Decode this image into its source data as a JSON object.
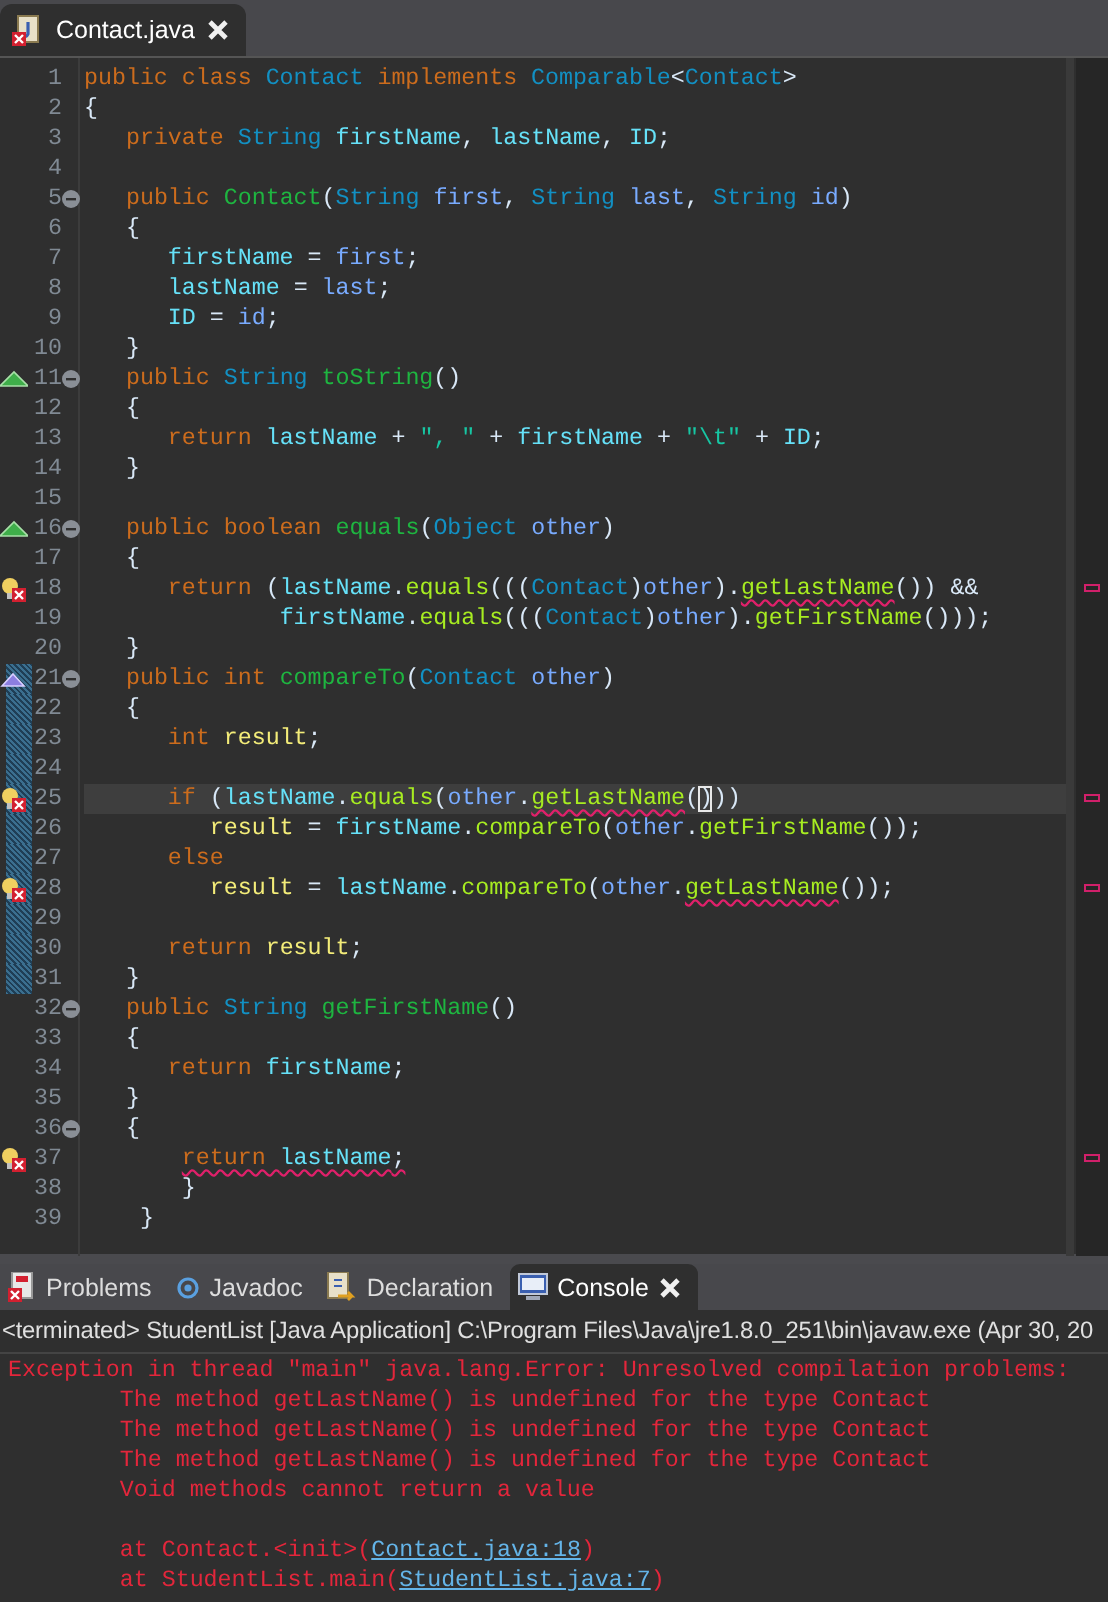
{
  "editor": {
    "tabs": [
      {
        "label": "Contact.java",
        "selected": true,
        "has_error": true
      }
    ],
    "lines": [
      {
        "number": "1",
        "fold": false,
        "changed": false,
        "current": false,
        "tokens": [
          {
            "text": "public class ",
            "kind": "keyword",
            "underlined": false
          },
          {
            "text": "Contact ",
            "kind": "type",
            "underlined": false
          },
          {
            "text": "implements ",
            "kind": "keyword",
            "underlined": false
          },
          {
            "text": "Comparable",
            "kind": "type",
            "underlined": false
          },
          {
            "text": "<",
            "kind": "plain",
            "underlined": false
          },
          {
            "text": "Contact",
            "kind": "type",
            "underlined": false
          },
          {
            "text": ">",
            "kind": "plain",
            "underlined": false
          }
        ]
      },
      {
        "number": "2",
        "fold": false,
        "changed": false,
        "current": false,
        "tokens": [
          {
            "text": "{",
            "kind": "plain",
            "underlined": false
          }
        ]
      },
      {
        "number": "3",
        "fold": false,
        "changed": false,
        "current": false,
        "tokens": [
          {
            "text": "   private ",
            "kind": "keyword",
            "underlined": false
          },
          {
            "text": "String ",
            "kind": "type",
            "underlined": false
          },
          {
            "text": "firstName",
            "kind": "field",
            "underlined": false
          },
          {
            "text": ", ",
            "kind": "plain",
            "underlined": false
          },
          {
            "text": "lastName",
            "kind": "field",
            "underlined": false
          },
          {
            "text": ", ",
            "kind": "plain",
            "underlined": false
          },
          {
            "text": "ID",
            "kind": "field",
            "underlined": false
          },
          {
            "text": ";",
            "kind": "plain",
            "underlined": false
          }
        ]
      },
      {
        "number": "4",
        "fold": false,
        "changed": false,
        "current": false
      },
      {
        "number": "5",
        "fold": true,
        "changed": false,
        "current": false,
        "tokens": [
          {
            "text": "   public ",
            "kind": "keyword",
            "underlined": false
          },
          {
            "text": "Contact",
            "kind": "declaration",
            "underlined": false
          },
          {
            "text": "(",
            "kind": "plain",
            "underlined": false
          },
          {
            "text": "String ",
            "kind": "type",
            "underlined": false
          },
          {
            "text": "first",
            "kind": "parameter",
            "underlined": false
          },
          {
            "text": ", ",
            "kind": "plain",
            "underlined": false
          },
          {
            "text": "String ",
            "kind": "type",
            "underlined": false
          },
          {
            "text": "last",
            "kind": "parameter",
            "underlined": false
          },
          {
            "text": ", ",
            "kind": "plain",
            "underlined": false
          },
          {
            "text": "String ",
            "kind": "type",
            "underlined": false
          },
          {
            "text": "id",
            "kind": "parameter",
            "underlined": false
          },
          {
            "text": ")",
            "kind": "plain",
            "underlined": false
          }
        ]
      },
      {
        "number": "6",
        "fold": false,
        "changed": false,
        "current": false,
        "tokens": [
          {
            "text": "   {",
            "kind": "plain",
            "underlined": false
          }
        ]
      },
      {
        "number": "7",
        "fold": false,
        "changed": false,
        "current": false,
        "tokens": [
          {
            "text": "      firstName",
            "kind": "field",
            "underlined": false
          },
          {
            "text": " = ",
            "kind": "plain",
            "underlined": false
          },
          {
            "text": "first",
            "kind": "parameter",
            "underlined": false
          },
          {
            "text": ";",
            "kind": "plain",
            "underlined": false
          }
        ]
      },
      {
        "number": "8",
        "fold": false,
        "changed": false,
        "current": false,
        "tokens": [
          {
            "text": "      lastName",
            "kind": "field",
            "underlined": false
          },
          {
            "text": " = ",
            "kind": "plain",
            "underlined": false
          },
          {
            "text": "last",
            "kind": "parameter",
            "underlined": false
          },
          {
            "text": ";",
            "kind": "plain",
            "underlined": false
          }
        ]
      },
      {
        "number": "9",
        "fold": false,
        "changed": false,
        "current": false,
        "tokens": [
          {
            "text": "      ID",
            "kind": "field",
            "underlined": false
          },
          {
            "text": " = ",
            "kind": "plain",
            "underlined": false
          },
          {
            "text": "id",
            "kind": "parameter",
            "underlined": false
          },
          {
            "text": ";",
            "kind": "plain",
            "underlined": false
          }
        ]
      },
      {
        "number": "10",
        "fold": false,
        "changed": false,
        "current": false,
        "tokens": [
          {
            "text": "   }",
            "kind": "plain",
            "underlined": false
          }
        ]
      },
      {
        "number": "11",
        "kind": "override",
        "fold": true,
        "changed": false,
        "current": false,
        "tokens": [
          {
            "text": "   public ",
            "kind": "keyword",
            "underlined": false
          },
          {
            "text": "String ",
            "kind": "type",
            "underlined": false
          },
          {
            "text": "toString",
            "kind": "declaration",
            "underlined": false
          },
          {
            "text": "()",
            "kind": "plain",
            "underlined": false
          }
        ]
      },
      {
        "number": "12",
        "fold": false,
        "changed": false,
        "current": false,
        "tokens": [
          {
            "text": "   {",
            "kind": "plain",
            "underlined": false
          }
        ]
      },
      {
        "number": "13",
        "fold": false,
        "changed": false,
        "current": false,
        "tokens": [
          {
            "text": "      return ",
            "kind": "keyword",
            "underlined": false
          },
          {
            "text": "lastName",
            "kind": "field",
            "underlined": false
          },
          {
            "text": " + ",
            "kind": "plain",
            "underlined": false
          },
          {
            "text": "\", \"",
            "kind": "string",
            "underlined": false
          },
          {
            "text": " + ",
            "kind": "plain",
            "underlined": false
          },
          {
            "text": "firstName",
            "kind": "field",
            "underlined": false
          },
          {
            "text": " + ",
            "kind": "plain",
            "underlined": false
          },
          {
            "text": "\"\\t\"",
            "kind": "string",
            "underlined": false
          },
          {
            "text": " + ",
            "kind": "plain",
            "underlined": false
          },
          {
            "text": "ID",
            "kind": "field",
            "underlined": false
          },
          {
            "text": ";",
            "kind": "plain",
            "underlined": false
          }
        ]
      },
      {
        "number": "14",
        "fold": false,
        "changed": false,
        "current": false,
        "tokens": [
          {
            "text": "   }",
            "kind": "plain",
            "underlined": false
          }
        ]
      },
      {
        "number": "15",
        "fold": false,
        "changed": false,
        "current": false
      },
      {
        "number": "16",
        "kind": "override",
        "fold": true,
        "changed": false,
        "current": false,
        "tokens": [
          {
            "text": "   public boolean ",
            "kind": "keyword",
            "underlined": false
          },
          {
            "text": "equals",
            "kind": "declaration",
            "underlined": false
          },
          {
            "text": "(",
            "kind": "plain",
            "underlined": false
          },
          {
            "text": "Object ",
            "kind": "type",
            "underlined": false
          },
          {
            "text": "other",
            "kind": "parameter",
            "underlined": false
          },
          {
            "text": ")",
            "kind": "plain",
            "underlined": false
          }
        ]
      },
      {
        "number": "17",
        "fold": false,
        "changed": false,
        "current": false,
        "tokens": [
          {
            "text": "   {",
            "kind": "plain",
            "underlined": false
          }
        ]
      },
      {
        "number": "18",
        "kind": "error",
        "fold": false,
        "changed": false,
        "current": false,
        "tokens": [
          {
            "text": "      return ",
            "kind": "keyword",
            "underlined": false
          },
          {
            "text": "(",
            "kind": "plain",
            "underlined": false
          },
          {
            "text": "lastName",
            "kind": "field",
            "underlined": false
          },
          {
            "text": ".",
            "kind": "plain",
            "underlined": false
          },
          {
            "text": "equals",
            "kind": "call",
            "underlined": false
          },
          {
            "text": "(((",
            "kind": "plain",
            "underlined": false
          },
          {
            "text": "Contact",
            "kind": "type",
            "underlined": false
          },
          {
            "text": ")",
            "kind": "plain",
            "underlined": false
          },
          {
            "text": "other",
            "kind": "parameter",
            "underlined": false
          },
          {
            "text": ").",
            "kind": "plain",
            "underlined": false
          },
          {
            "text": "getLastName",
            "kind": "call",
            "underlined": true
          },
          {
            "text": "()) &&",
            "kind": "plain",
            "underlined": false
          }
        ]
      },
      {
        "number": "19",
        "fold": false,
        "changed": false,
        "current": false,
        "tokens": [
          {
            "text": "              firstName",
            "kind": "field",
            "underlined": false
          },
          {
            "text": ".",
            "kind": "plain",
            "underlined": false
          },
          {
            "text": "equals",
            "kind": "call",
            "underlined": false
          },
          {
            "text": "(((",
            "kind": "plain",
            "underlined": false
          },
          {
            "text": "Contact",
            "kind": "type",
            "underlined": false
          },
          {
            "text": ")",
            "kind": "plain",
            "underlined": false
          },
          {
            "text": "other",
            "kind": "parameter",
            "underlined": false
          },
          {
            "text": ").",
            "kind": "plain",
            "underlined": false
          },
          {
            "text": "getFirstName",
            "kind": "call",
            "underlined": false
          },
          {
            "text": "()));",
            "kind": "plain",
            "underlined": false
          }
        ]
      },
      {
        "number": "20",
        "fold": false,
        "changed": false,
        "current": false,
        "tokens": [
          {
            "text": "   }",
            "kind": "plain",
            "underlined": false
          }
        ]
      },
      {
        "number": "21",
        "kind": "implements",
        "fold": true,
        "changed": true,
        "current": false,
        "tokens": [
          {
            "text": "   public int ",
            "kind": "keyword",
            "underlined": false
          },
          {
            "text": "compareTo",
            "kind": "declaration",
            "underlined": false
          },
          {
            "text": "(",
            "kind": "plain",
            "underlined": false
          },
          {
            "text": "Contact ",
            "kind": "type",
            "underlined": false
          },
          {
            "text": "other",
            "kind": "parameter",
            "underlined": false
          },
          {
            "text": ")",
            "kind": "plain",
            "underlined": false
          }
        ]
      },
      {
        "number": "22",
        "fold": false,
        "changed": true,
        "current": false,
        "tokens": [
          {
            "text": "   {",
            "kind": "plain",
            "underlined": false
          }
        ]
      },
      {
        "number": "23",
        "fold": false,
        "changed": true,
        "current": false,
        "tokens": [
          {
            "text": "      int ",
            "kind": "keyword",
            "underlined": false
          },
          {
            "text": "result",
            "kind": "local",
            "underlined": false
          },
          {
            "text": ";",
            "kind": "plain",
            "underlined": false
          }
        ]
      },
      {
        "number": "24",
        "fold": false,
        "changed": true,
        "current": false
      },
      {
        "number": "25",
        "kind": "error",
        "fold": false,
        "changed": true,
        "current": true,
        "tokens": [
          {
            "text": "      if ",
            "kind": "keyword",
            "underlined": false
          },
          {
            "text": "(",
            "kind": "plain",
            "underlined": false
          },
          {
            "text": "lastName",
            "kind": "field",
            "underlined": false
          },
          {
            "text": ".",
            "kind": "plain",
            "underlined": false
          },
          {
            "text": "equals",
            "kind": "call",
            "underlined": false
          },
          {
            "text": "(",
            "kind": "plain",
            "underlined": false
          },
          {
            "text": "other",
            "kind": "parameter",
            "underlined": false
          },
          {
            "text": ".",
            "kind": "plain",
            "underlined": false
          },
          {
            "text": "getLastName",
            "kind": "call",
            "underlined": true
          },
          {
            "text": "(",
            "kind": "plain",
            "underlined": false
          },
          {
            "text": ")",
            "kind": "bracket",
            "underlined": false
          },
          {
            "text": "))",
            "kind": "plain",
            "underlined": false
          }
        ]
      },
      {
        "number": "26",
        "fold": false,
        "changed": true,
        "current": false,
        "tokens": [
          {
            "text": "         result",
            "kind": "local",
            "underlined": false
          },
          {
            "text": " = ",
            "kind": "plain",
            "underlined": false
          },
          {
            "text": "firstName",
            "kind": "field",
            "underlined": false
          },
          {
            "text": ".",
            "kind": "plain",
            "underlined": false
          },
          {
            "text": "compareTo",
            "kind": "call",
            "underlined": false
          },
          {
            "text": "(",
            "kind": "plain",
            "underlined": false
          },
          {
            "text": "other",
            "kind": "parameter",
            "underlined": false
          },
          {
            "text": ".",
            "kind": "plain",
            "underlined": false
          },
          {
            "text": "getFirstName",
            "kind": "call",
            "underlined": false
          },
          {
            "text": "());",
            "kind": "plain",
            "underlined": false
          }
        ]
      },
      {
        "number": "27",
        "fold": false,
        "changed": true,
        "current": false,
        "tokens": [
          {
            "text": "      else",
            "kind": "keyword",
            "underlined": false
          }
        ]
      },
      {
        "number": "28",
        "kind": "error",
        "fold": false,
        "changed": true,
        "current": false,
        "tokens": [
          {
            "text": "         result",
            "kind": "local",
            "underlined": false
          },
          {
            "text": " = ",
            "kind": "plain",
            "underlined": false
          },
          {
            "text": "lastName",
            "kind": "field",
            "underlined": false
          },
          {
            "text": ".",
            "kind": "plain",
            "underlined": false
          },
          {
            "text": "compareTo",
            "kind": "call",
            "underlined": false
          },
          {
            "text": "(",
            "kind": "plain",
            "underlined": false
          },
          {
            "text": "other",
            "kind": "parameter",
            "underlined": false
          },
          {
            "text": ".",
            "kind": "plain",
            "underlined": false
          },
          {
            "text": "getLastName",
            "kind": "call",
            "underlined": true
          },
          {
            "text": "());",
            "kind": "plain",
            "underlined": false
          }
        ]
      },
      {
        "number": "29",
        "fold": false,
        "changed": true,
        "current": false
      },
      {
        "number": "30",
        "fold": false,
        "changed": true,
        "current": false,
        "tokens": [
          {
            "text": "      return ",
            "kind": "keyword",
            "underlined": false
          },
          {
            "text": "result",
            "kind": "local",
            "underlined": false
          },
          {
            "text": ";",
            "kind": "plain",
            "underlined": false
          }
        ]
      },
      {
        "number": "31",
        "fold": false,
        "changed": true,
        "current": false,
        "tokens": [
          {
            "text": "   }",
            "kind": "plain",
            "underlined": false
          }
        ]
      },
      {
        "number": "32",
        "fold": true,
        "changed": false,
        "current": false,
        "tokens": [
          {
            "text": "   public ",
            "kind": "keyword",
            "underlined": false
          },
          {
            "text": "String ",
            "kind": "type",
            "underlined": false
          },
          {
            "text": "getFirstName",
            "kind": "declaration",
            "underlined": false
          },
          {
            "text": "()",
            "kind": "plain",
            "underlined": false
          }
        ]
      },
      {
        "number": "33",
        "fold": false,
        "changed": false,
        "current": false,
        "tokens": [
          {
            "text": "   {",
            "kind": "plain",
            "underlined": false
          }
        ]
      },
      {
        "number": "34",
        "fold": false,
        "changed": false,
        "current": false,
        "tokens": [
          {
            "text": "      return ",
            "kind": "keyword",
            "underlined": false
          },
          {
            "text": "firstName",
            "kind": "field",
            "underlined": false
          },
          {
            "text": ";",
            "kind": "plain",
            "underlined": false
          }
        ]
      },
      {
        "number": "35",
        "fold": false,
        "changed": false,
        "current": false,
        "tokens": [
          {
            "text": "   }",
            "kind": "plain",
            "underlined": false
          }
        ]
      },
      {
        "number": "36",
        "fold": true,
        "changed": false,
        "current": false,
        "tokens": [
          {
            "text": "   {",
            "kind": "plain",
            "underlined": false
          }
        ]
      },
      {
        "number": "37",
        "kind": "error",
        "fold": false,
        "changed": false,
        "current": false,
        "tokens": [
          {
            "text": "       return ",
            "kind": "keyword",
            "underlined": true
          },
          {
            "text": "lastName",
            "kind": "field",
            "underlined": true
          },
          {
            "text": ";",
            "kind": "plain",
            "underlined": true
          }
        ]
      },
      {
        "number": "38",
        "fold": false,
        "changed": false,
        "current": false,
        "tokens": [
          {
            "text": "       }",
            "kind": "plain",
            "underlined": false
          }
        ]
      },
      {
        "number": "39",
        "fold": false,
        "changed": false,
        "current": false,
        "tokens": [
          {
            "text": "    }",
            "kind": "plain",
            "underlined": false
          }
        ]
      }
    ]
  },
  "panel": {
    "tabs": [
      {
        "label": "Problems",
        "kind": "problems",
        "selected": false
      },
      {
        "label": "Javadoc",
        "kind": "javadoc",
        "selected": false
      },
      {
        "label": "Declaration",
        "kind": "declaration",
        "selected": false
      },
      {
        "label": "Console",
        "kind": "console",
        "selected": true
      }
    ],
    "header": "<terminated> StudentList [Java Application] C:\\Program Files\\Java\\jre1.8.0_251\\bin\\javaw.exe (Apr 30, 20",
    "messages": [
      "Exception in thread \"main\" java.lang.Error: Unresolved compilation problems:",
      "\tThe method getLastName() is undefined for the type Contact",
      "\tThe method getLastName() is undefined for the type Contact",
      "\tThe method getLastName() is undefined for the type Contact",
      "\tVoid methods cannot return a value"
    ],
    "trace": [
      {
        "text": "\tat Contact.<init>(",
        "link": "Contact.java:18",
        "close": ")"
      },
      {
        "text": "\tat StudentList.main(",
        "link": "StudentList.java:7",
        "close": ")"
      }
    ]
  }
}
